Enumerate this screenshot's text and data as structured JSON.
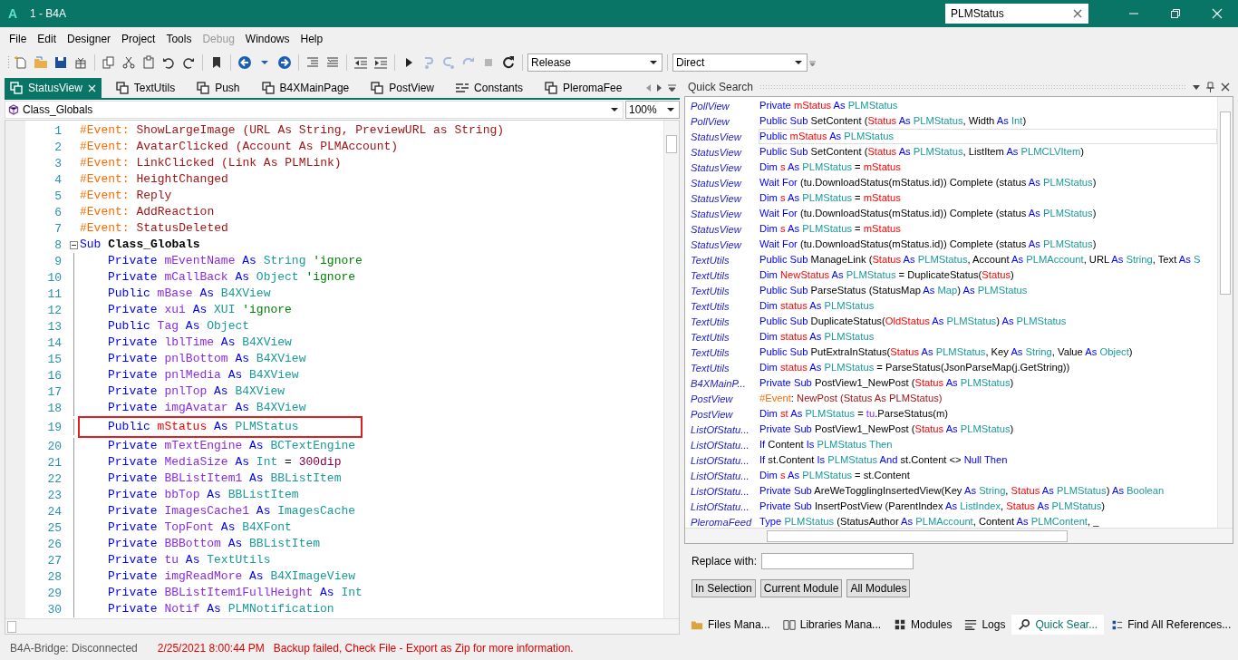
{
  "window": {
    "logo": "A",
    "title": "1 - B4A",
    "search": {
      "value": "PLMStatus"
    }
  },
  "menu": [
    {
      "label": "File",
      "disabled": false
    },
    {
      "label": "Edit",
      "disabled": false
    },
    {
      "label": "Designer",
      "disabled": false
    },
    {
      "label": "Project",
      "disabled": false
    },
    {
      "label": "Tools",
      "disabled": false
    },
    {
      "label": "Debug",
      "disabled": true
    },
    {
      "label": "Windows",
      "disabled": false
    },
    {
      "label": "Help",
      "disabled": false
    }
  ],
  "toolbar": {
    "buttons": [
      {
        "disabled": false
      },
      {
        "disabled": false
      },
      {
        "disabled": false
      },
      {
        "disabled": false
      },
      {
        "disabled": false
      },
      {
        "disabled": false
      },
      {
        "disabled": false
      },
      {
        "disabled": false
      },
      {
        "disabled": false
      },
      {
        "disabled": false
      },
      {
        "disabled": false
      },
      {
        "disabled": false
      },
      {
        "disabled": false
      },
      {
        "disabled": false
      },
      {
        "disabled": false
      },
      {
        "disabled": false
      },
      {
        "disabled": false
      },
      {
        "disabled": false
      },
      {
        "disabled": true
      },
      {
        "disabled": true
      },
      {
        "disabled": true
      },
      {
        "disabled": true
      },
      {
        "disabled": false
      }
    ],
    "configuration": "Release",
    "connection": "Direct"
  },
  "editor_tabs": [
    {
      "label": "StatusView",
      "kind": "module",
      "selected": true
    },
    {
      "label": "TextUtils",
      "kind": "module",
      "selected": false
    },
    {
      "label": "Push",
      "kind": "module",
      "selected": false
    },
    {
      "label": "B4XMainPage",
      "kind": "module",
      "selected": false
    },
    {
      "label": "PostView",
      "kind": "module",
      "selected": false
    },
    {
      "label": "Constants",
      "kind": "constants",
      "selected": false
    },
    {
      "label": "PleromaFee",
      "kind": "module",
      "selected": false
    }
  ],
  "member_dropdown": "Class_Globals",
  "zoom": "100%",
  "code": {
    "lines": [
      {
        "number": "1",
        "marked": false,
        "tokens": [
          {
            "kind": "ev",
            "text": "#Event:"
          },
          {
            "kind": "evt",
            "text": " ShowLargeImage (URL As String, PreviewURL as String)"
          }
        ]
      },
      {
        "number": "2",
        "marked": false,
        "tokens": [
          {
            "kind": "ev",
            "text": "#Event:"
          },
          {
            "kind": "evt",
            "text": " AvatarClicked (Account As PLMAccount)"
          }
        ]
      },
      {
        "number": "3",
        "marked": false,
        "tokens": [
          {
            "kind": "ev",
            "text": "#Event:"
          },
          {
            "kind": "evt",
            "text": " LinkClicked (Link As PLMLink)"
          }
        ]
      },
      {
        "number": "4",
        "marked": false,
        "tokens": [
          {
            "kind": "ev",
            "text": "#Event:"
          },
          {
            "kind": "evt",
            "text": " HeightChanged"
          }
        ]
      },
      {
        "number": "5",
        "marked": false,
        "tokens": [
          {
            "kind": "ev",
            "text": "#Event:"
          },
          {
            "kind": "evt",
            "text": " Reply"
          }
        ]
      },
      {
        "number": "6",
        "marked": false,
        "tokens": [
          {
            "kind": "ev",
            "text": "#Event:"
          },
          {
            "kind": "evt",
            "text": " AddReaction"
          }
        ]
      },
      {
        "number": "7",
        "marked": false,
        "tokens": [
          {
            "kind": "ev",
            "text": "#Event:"
          },
          {
            "kind": "evt",
            "text": " StatusDeleted"
          }
        ]
      },
      {
        "number": "8",
        "marked": false,
        "expanded": true,
        "tokens": [
          {
            "kind": "kw",
            "text": "Sub "
          },
          {
            "kind": "bold",
            "text": "Class_Globals"
          }
        ],
        "children": [
          {
            "number": "9",
            "marked": false,
            "tokens": [
              {
                "kind": "kw",
                "text": "Private "
              },
              {
                "kind": "var",
                "text": "mEventName "
              },
              {
                "kind": "kw",
                "text": "As "
              },
              {
                "kind": "type",
                "text": "String "
              },
              {
                "kind": "cm",
                "text": "'ignore"
              }
            ]
          },
          {
            "number": "10",
            "marked": false,
            "tokens": [
              {
                "kind": "kw",
                "text": "Private "
              },
              {
                "kind": "var",
                "text": "mCallBack "
              },
              {
                "kind": "kw",
                "text": "As "
              },
              {
                "kind": "type",
                "text": "Object "
              },
              {
                "kind": "cm",
                "text": "'ignore"
              }
            ]
          },
          {
            "number": "11",
            "marked": false,
            "tokens": [
              {
                "kind": "kw",
                "text": "Public "
              },
              {
                "kind": "var",
                "text": "mBase "
              },
              {
                "kind": "kw",
                "text": "As "
              },
              {
                "kind": "type",
                "text": "B4XView"
              }
            ]
          },
          {
            "number": "12",
            "marked": false,
            "tokens": [
              {
                "kind": "kw",
                "text": "Private "
              },
              {
                "kind": "var",
                "text": "xui "
              },
              {
                "kind": "kw",
                "text": "As "
              },
              {
                "kind": "type",
                "text": "XUI "
              },
              {
                "kind": "cm",
                "text": "'ignore"
              }
            ]
          },
          {
            "number": "13",
            "marked": false,
            "tokens": [
              {
                "kind": "kw",
                "text": "Public "
              },
              {
                "kind": "var",
                "text": "Tag "
              },
              {
                "kind": "kw",
                "text": "As "
              },
              {
                "kind": "type",
                "text": "Object"
              }
            ]
          },
          {
            "number": "14",
            "marked": false,
            "tokens": [
              {
                "kind": "kw",
                "text": "Private "
              },
              {
                "kind": "var",
                "text": "lblTime "
              },
              {
                "kind": "kw",
                "text": "As "
              },
              {
                "kind": "type",
                "text": "B4XView"
              }
            ]
          },
          {
            "number": "15",
            "marked": false,
            "tokens": [
              {
                "kind": "kw",
                "text": "Private "
              },
              {
                "kind": "var",
                "text": "pnlBottom "
              },
              {
                "kind": "kw",
                "text": "As "
              },
              {
                "kind": "type",
                "text": "B4XView"
              }
            ]
          },
          {
            "number": "16",
            "marked": false,
            "tokens": [
              {
                "kind": "kw",
                "text": "Private "
              },
              {
                "kind": "var",
                "text": "pnlMedia "
              },
              {
                "kind": "kw",
                "text": "As "
              },
              {
                "kind": "type",
                "text": "B4XView"
              }
            ]
          },
          {
            "number": "17",
            "marked": false,
            "tokens": [
              {
                "kind": "kw",
                "text": "Private "
              },
              {
                "kind": "var",
                "text": "pnlTop "
              },
              {
                "kind": "kw",
                "text": "As "
              },
              {
                "kind": "type",
                "text": "B4XView"
              }
            ]
          },
          {
            "number": "18",
            "marked": false,
            "tokens": [
              {
                "kind": "kw",
                "text": "Private "
              },
              {
                "kind": "var",
                "text": "imgAvatar "
              },
              {
                "kind": "kw",
                "text": "As "
              },
              {
                "kind": "type",
                "text": "B4XView"
              }
            ]
          },
          {
            "number": "19",
            "marked": true,
            "tokens": [
              {
                "kind": "kw",
                "text": "Public "
              },
              {
                "kind": "hit",
                "text": "mStatus "
              },
              {
                "kind": "kw",
                "text": "As "
              },
              {
                "kind": "type",
                "text": "PLMStatus"
              }
            ]
          },
          {
            "number": "20",
            "marked": false,
            "tokens": [
              {
                "kind": "kw",
                "text": "Private "
              },
              {
                "kind": "var",
                "text": "mTextEngine "
              },
              {
                "kind": "kw",
                "text": "As "
              },
              {
                "kind": "type",
                "text": "BCTextEngine"
              }
            ]
          },
          {
            "number": "21",
            "marked": false,
            "tokens": [
              {
                "kind": "kw",
                "text": "Private "
              },
              {
                "kind": "var",
                "text": "MediaSize "
              },
              {
                "kind": "kw",
                "text": "As "
              },
              {
                "kind": "type",
                "text": "Int"
              },
              {
                "kind": "pl",
                "text": " = "
              },
              {
                "kind": "num",
                "text": "300dip"
              }
            ]
          },
          {
            "number": "22",
            "marked": false,
            "tokens": [
              {
                "kind": "kw",
                "text": "Private "
              },
              {
                "kind": "var",
                "text": "BBListItem1 "
              },
              {
                "kind": "kw",
                "text": "As "
              },
              {
                "kind": "type",
                "text": "BBListItem"
              }
            ]
          },
          {
            "number": "23",
            "marked": false,
            "tokens": [
              {
                "kind": "kw",
                "text": "Private "
              },
              {
                "kind": "var",
                "text": "bbTop "
              },
              {
                "kind": "kw",
                "text": "As "
              },
              {
                "kind": "type",
                "text": "BBListItem"
              }
            ]
          },
          {
            "number": "24",
            "marked": false,
            "tokens": [
              {
                "kind": "kw",
                "text": "Private "
              },
              {
                "kind": "var",
                "text": "ImagesCache1 "
              },
              {
                "kind": "kw",
                "text": "As "
              },
              {
                "kind": "type",
                "text": "ImagesCache"
              }
            ]
          },
          {
            "number": "25",
            "marked": false,
            "tokens": [
              {
                "kind": "kw",
                "text": "Private "
              },
              {
                "kind": "var",
                "text": "TopFont "
              },
              {
                "kind": "kw",
                "text": "As "
              },
              {
                "kind": "type",
                "text": "B4XFont"
              }
            ]
          },
          {
            "number": "26",
            "marked": false,
            "tokens": [
              {
                "kind": "kw",
                "text": "Private "
              },
              {
                "kind": "var",
                "text": "BBBottom "
              },
              {
                "kind": "kw",
                "text": "As "
              },
              {
                "kind": "type",
                "text": "BBListItem"
              }
            ]
          },
          {
            "number": "27",
            "marked": false,
            "tokens": [
              {
                "kind": "kw",
                "text": "Private "
              },
              {
                "kind": "var",
                "text": "tu "
              },
              {
                "kind": "kw",
                "text": "As "
              },
              {
                "kind": "type",
                "text": "TextUtils"
              }
            ]
          },
          {
            "number": "28",
            "marked": false,
            "tokens": [
              {
                "kind": "kw",
                "text": "Private "
              },
              {
                "kind": "var",
                "text": "imgReadMore "
              },
              {
                "kind": "kw",
                "text": "As "
              },
              {
                "kind": "type",
                "text": "B4XImageView"
              }
            ]
          },
          {
            "number": "29",
            "marked": false,
            "tokens": [
              {
                "kind": "kw",
                "text": "Private "
              },
              {
                "kind": "var",
                "text": "BBListItem1FullHeight "
              },
              {
                "kind": "kw",
                "text": "As "
              },
              {
                "kind": "type",
                "text": "Int"
              }
            ]
          },
          {
            "number": "30",
            "marked": false,
            "tokens": [
              {
                "kind": "kw",
                "text": "Private "
              },
              {
                "kind": "var",
                "text": "Notif "
              },
              {
                "kind": "kw",
                "text": "As "
              },
              {
                "kind": "type",
                "text": "PLMNotification"
              }
            ]
          }
        ]
      }
    ]
  },
  "quick_search": {
    "title": "Quick Search",
    "results": [
      {
        "module": "PollView",
        "selected": false,
        "tokens": [
          {
            "kind": "kw",
            "text": "Private "
          },
          {
            "kind": "hit",
            "text": "mStatus "
          },
          {
            "kind": "kw",
            "text": "As "
          },
          {
            "kind": "type",
            "text": "PLMStatus"
          }
        ]
      },
      {
        "module": "PollView",
        "selected": false,
        "tokens": [
          {
            "kind": "kw",
            "text": "Public Sub "
          },
          {
            "kind": "pl",
            "text": "SetContent ("
          },
          {
            "kind": "hit",
            "text": "Status "
          },
          {
            "kind": "kw",
            "text": "As "
          },
          {
            "kind": "type",
            "text": "PLMStatus"
          },
          {
            "kind": "pl",
            "text": ", Width "
          },
          {
            "kind": "kw",
            "text": "As "
          },
          {
            "kind": "type",
            "text": "Int"
          },
          {
            "kind": "pl",
            "text": ")"
          }
        ]
      },
      {
        "module": "StatusView",
        "selected": true,
        "tokens": [
          {
            "kind": "kw",
            "text": "Public "
          },
          {
            "kind": "hit",
            "text": "mStatus "
          },
          {
            "kind": "kw",
            "text": "As "
          },
          {
            "kind": "type",
            "text": "PLMStatus"
          }
        ]
      },
      {
        "module": "StatusView",
        "selected": false,
        "tokens": [
          {
            "kind": "kw",
            "text": "Public Sub "
          },
          {
            "kind": "pl",
            "text": "SetContent ("
          },
          {
            "kind": "hit",
            "text": "Status "
          },
          {
            "kind": "kw",
            "text": "As "
          },
          {
            "kind": "type",
            "text": "PLMStatus"
          },
          {
            "kind": "pl",
            "text": ", ListItem "
          },
          {
            "kind": "kw",
            "text": "As "
          },
          {
            "kind": "type",
            "text": "PLMCLVItem"
          },
          {
            "kind": "pl",
            "text": ")"
          }
        ]
      },
      {
        "module": "StatusView",
        "selected": false,
        "tokens": [
          {
            "kind": "kw",
            "text": "Dim "
          },
          {
            "kind": "hit",
            "text": "s "
          },
          {
            "kind": "kw",
            "text": "As "
          },
          {
            "kind": "type",
            "text": "PLMStatus"
          },
          {
            "kind": "pl",
            "text": " = "
          },
          {
            "kind": "hit",
            "text": "mStatus"
          }
        ]
      },
      {
        "module": "StatusView",
        "selected": false,
        "tokens": [
          {
            "kind": "kw",
            "text": "Wait For "
          },
          {
            "kind": "pl",
            "text": "(tu.DownloadStatus(mStatus.id)) Complete (status "
          },
          {
            "kind": "kw",
            "text": "As "
          },
          {
            "kind": "type",
            "text": "PLMStatus"
          },
          {
            "kind": "pl",
            "text": ")"
          }
        ]
      },
      {
        "module": "StatusView",
        "selected": false,
        "tokens": [
          {
            "kind": "kw",
            "text": "Dim "
          },
          {
            "kind": "hit",
            "text": "s "
          },
          {
            "kind": "kw",
            "text": "As "
          },
          {
            "kind": "type",
            "text": "PLMStatus"
          },
          {
            "kind": "pl",
            "text": " = "
          },
          {
            "kind": "hit",
            "text": "mStatus"
          }
        ]
      },
      {
        "module": "StatusView",
        "selected": false,
        "tokens": [
          {
            "kind": "kw",
            "text": "Wait For "
          },
          {
            "kind": "pl",
            "text": "(tu.DownloadStatus(mStatus.id)) Complete (status "
          },
          {
            "kind": "kw",
            "text": "As "
          },
          {
            "kind": "type",
            "text": "PLMStatus"
          },
          {
            "kind": "pl",
            "text": ")"
          }
        ]
      },
      {
        "module": "StatusView",
        "selected": false,
        "tokens": [
          {
            "kind": "kw",
            "text": "Dim "
          },
          {
            "kind": "hit",
            "text": "s "
          },
          {
            "kind": "kw",
            "text": "As "
          },
          {
            "kind": "type",
            "text": "PLMStatus"
          },
          {
            "kind": "pl",
            "text": " = "
          },
          {
            "kind": "hit",
            "text": "mStatus"
          }
        ]
      },
      {
        "module": "StatusView",
        "selected": false,
        "tokens": [
          {
            "kind": "kw",
            "text": "Wait For "
          },
          {
            "kind": "pl",
            "text": "(tu.DownloadStatus(mStatus.id)) Complete (status "
          },
          {
            "kind": "kw",
            "text": "As "
          },
          {
            "kind": "type",
            "text": "PLMStatus"
          },
          {
            "kind": "pl",
            "text": ")"
          }
        ]
      },
      {
        "module": "TextUtils",
        "selected": false,
        "tokens": [
          {
            "kind": "kw",
            "text": "Public Sub "
          },
          {
            "kind": "pl",
            "text": "ManageLink ("
          },
          {
            "kind": "hit",
            "text": "Status "
          },
          {
            "kind": "kw",
            "text": "As "
          },
          {
            "kind": "type",
            "text": "PLMStatus"
          },
          {
            "kind": "pl",
            "text": ", Account "
          },
          {
            "kind": "kw",
            "text": "As "
          },
          {
            "kind": "type",
            "text": "PLMAccount"
          },
          {
            "kind": "pl",
            "text": ", URL "
          },
          {
            "kind": "kw",
            "text": "As "
          },
          {
            "kind": "type",
            "text": "String"
          },
          {
            "kind": "pl",
            "text": ", Text "
          },
          {
            "kind": "kw",
            "text": "As "
          },
          {
            "kind": "type",
            "text": "S"
          }
        ]
      },
      {
        "module": "TextUtils",
        "selected": false,
        "tokens": [
          {
            "kind": "kw",
            "text": "Dim "
          },
          {
            "kind": "hit",
            "text": "NewStatus "
          },
          {
            "kind": "kw",
            "text": "As "
          },
          {
            "kind": "type",
            "text": "PLMStatus"
          },
          {
            "kind": "pl",
            "text": " = DuplicateStatus("
          },
          {
            "kind": "hit",
            "text": "Status"
          },
          {
            "kind": "pl",
            "text": ")"
          }
        ]
      },
      {
        "module": "TextUtils",
        "selected": false,
        "tokens": [
          {
            "kind": "kw",
            "text": "Public Sub "
          },
          {
            "kind": "pl",
            "text": "ParseStatus (StatusMap "
          },
          {
            "kind": "kw",
            "text": "As "
          },
          {
            "kind": "type",
            "text": "Map"
          },
          {
            "kind": "pl",
            "text": ") "
          },
          {
            "kind": "kw",
            "text": "As "
          },
          {
            "kind": "type",
            "text": "PLMStatus"
          }
        ]
      },
      {
        "module": "TextUtils",
        "selected": false,
        "tokens": [
          {
            "kind": "kw",
            "text": "Dim "
          },
          {
            "kind": "hit",
            "text": "status "
          },
          {
            "kind": "kw",
            "text": "As "
          },
          {
            "kind": "type",
            "text": "PLMStatus"
          }
        ]
      },
      {
        "module": "TextUtils",
        "selected": false,
        "tokens": [
          {
            "kind": "kw",
            "text": "Public Sub "
          },
          {
            "kind": "pl",
            "text": "DuplicateStatus("
          },
          {
            "kind": "hit",
            "text": "OldStatus "
          },
          {
            "kind": "kw",
            "text": "As "
          },
          {
            "kind": "type",
            "text": "PLMStatus"
          },
          {
            "kind": "pl",
            "text": ") "
          },
          {
            "kind": "kw",
            "text": "As "
          },
          {
            "kind": "type",
            "text": "PLMStatus"
          }
        ]
      },
      {
        "module": "TextUtils",
        "selected": false,
        "tokens": [
          {
            "kind": "kw",
            "text": "Dim "
          },
          {
            "kind": "hit",
            "text": "status "
          },
          {
            "kind": "kw",
            "text": "As "
          },
          {
            "kind": "type",
            "text": "PLMStatus"
          }
        ]
      },
      {
        "module": "TextUtils",
        "selected": false,
        "tokens": [
          {
            "kind": "kw",
            "text": "Public Sub "
          },
          {
            "kind": "pl",
            "text": "PutExtraInStatus("
          },
          {
            "kind": "hit",
            "text": "Status "
          },
          {
            "kind": "kw",
            "text": "As "
          },
          {
            "kind": "type",
            "text": "PLMStatus"
          },
          {
            "kind": "pl",
            "text": ", Key "
          },
          {
            "kind": "kw",
            "text": "As "
          },
          {
            "kind": "type",
            "text": "String"
          },
          {
            "kind": "pl",
            "text": ", Value "
          },
          {
            "kind": "kw",
            "text": "As "
          },
          {
            "kind": "type",
            "text": "Object"
          },
          {
            "kind": "pl",
            "text": ")"
          }
        ]
      },
      {
        "module": "TextUtils",
        "selected": false,
        "tokens": [
          {
            "kind": "kw",
            "text": "Dim "
          },
          {
            "kind": "hit",
            "text": "status "
          },
          {
            "kind": "kw",
            "text": "As "
          },
          {
            "kind": "type",
            "text": "PLMStatus"
          },
          {
            "kind": "pl",
            "text": " = ParseStatus(JsonParseMap(j.GetString))"
          }
        ]
      },
      {
        "module": "B4XMainP...",
        "selected": false,
        "tokens": [
          {
            "kind": "kw",
            "text": "Private Sub "
          },
          {
            "kind": "pl",
            "text": "PostView1_NewPost ("
          },
          {
            "kind": "hit",
            "text": "Status "
          },
          {
            "kind": "kw",
            "text": "As "
          },
          {
            "kind": "type",
            "text": "PLMStatus"
          },
          {
            "kind": "pl",
            "text": ")"
          }
        ]
      },
      {
        "module": "PostView",
        "selected": false,
        "tokens": [
          {
            "kind": "ev",
            "text": "#Event"
          },
          {
            "kind": "pl",
            "text": ": "
          },
          {
            "kind": "evt",
            "text": "NewPost (Status As PLMStatus)"
          }
        ]
      },
      {
        "module": "PostView",
        "selected": false,
        "tokens": [
          {
            "kind": "kw",
            "text": "Dim "
          },
          {
            "kind": "hit",
            "text": "st "
          },
          {
            "kind": "kw",
            "text": "As "
          },
          {
            "kind": "type",
            "text": "PLMStatus"
          },
          {
            "kind": "pl",
            "text": " = "
          },
          {
            "kind": "var",
            "text": "tu"
          },
          {
            "kind": "pl",
            "text": ".ParseStatus(m)"
          }
        ]
      },
      {
        "module": "ListOfStatu...",
        "selected": false,
        "tokens": [
          {
            "kind": "kw",
            "text": "Private Sub "
          },
          {
            "kind": "pl",
            "text": "PostView1_NewPost ("
          },
          {
            "kind": "hit",
            "text": "Status "
          },
          {
            "kind": "kw",
            "text": "As "
          },
          {
            "kind": "type",
            "text": "PLMStatus"
          },
          {
            "kind": "pl",
            "text": ")"
          }
        ]
      },
      {
        "module": "ListOfStatu...",
        "selected": false,
        "tokens": [
          {
            "kind": "kw",
            "text": "If "
          },
          {
            "kind": "pl",
            "text": "Content "
          },
          {
            "kind": "kw",
            "text": "Is "
          },
          {
            "kind": "type",
            "text": "PLMStatus Then"
          }
        ]
      },
      {
        "module": "ListOfStatu...",
        "selected": false,
        "tokens": [
          {
            "kind": "kw",
            "text": "If "
          },
          {
            "kind": "pl",
            "text": "st.Content "
          },
          {
            "kind": "kw",
            "text": "Is "
          },
          {
            "kind": "type",
            "text": "PLMStatus "
          },
          {
            "kind": "kw",
            "text": "And "
          },
          {
            "kind": "pl",
            "text": "st.Content <> "
          },
          {
            "kind": "kw",
            "text": "Null Then"
          }
        ]
      },
      {
        "module": "ListOfStatu...",
        "selected": false,
        "tokens": [
          {
            "kind": "kw",
            "text": "Dim "
          },
          {
            "kind": "hit",
            "text": "s "
          },
          {
            "kind": "kw",
            "text": "As "
          },
          {
            "kind": "type",
            "text": "PLMStatus"
          },
          {
            "kind": "pl",
            "text": " = st.Content"
          }
        ]
      },
      {
        "module": "ListOfStatu...",
        "selected": false,
        "tokens": [
          {
            "kind": "kw",
            "text": "Private Sub "
          },
          {
            "kind": "pl",
            "text": "AreWeTogglingInsertedView(Key "
          },
          {
            "kind": "kw",
            "text": "As "
          },
          {
            "kind": "type",
            "text": "String"
          },
          {
            "kind": "pl",
            "text": ", "
          },
          {
            "kind": "hit",
            "text": "Status "
          },
          {
            "kind": "kw",
            "text": "As "
          },
          {
            "kind": "type",
            "text": "PLMStatus"
          },
          {
            "kind": "pl",
            "text": ") "
          },
          {
            "kind": "kw",
            "text": "As "
          },
          {
            "kind": "type",
            "text": "Boolean"
          }
        ]
      },
      {
        "module": "ListOfStatu...",
        "selected": false,
        "tokens": [
          {
            "kind": "kw",
            "text": "Private Sub "
          },
          {
            "kind": "pl",
            "text": "InsertPostView (ParentIndex "
          },
          {
            "kind": "kw",
            "text": "As "
          },
          {
            "kind": "type",
            "text": "ListIndex"
          },
          {
            "kind": "pl",
            "text": ", "
          },
          {
            "kind": "hit",
            "text": "Status "
          },
          {
            "kind": "kw",
            "text": "As "
          },
          {
            "kind": "type",
            "text": "PLMStatus"
          },
          {
            "kind": "pl",
            "text": ")"
          }
        ]
      },
      {
        "module": "PleromaFeed",
        "selected": false,
        "tokens": [
          {
            "kind": "kw",
            "text": "Type "
          },
          {
            "kind": "type",
            "text": "PLMStatus "
          },
          {
            "kind": "pl",
            "text": "(StatusAuthor "
          },
          {
            "kind": "kw",
            "text": "As "
          },
          {
            "kind": "type",
            "text": "PLMAccount"
          },
          {
            "kind": "pl",
            "text": ", Content "
          },
          {
            "kind": "kw",
            "text": "As "
          },
          {
            "kind": "type",
            "text": "PLMContent"
          },
          {
            "kind": "pl",
            "text": ", _"
          }
        ]
      }
    ],
    "replace_label": "Replace with:",
    "buttons": [
      "In Selection",
      "Current Module",
      "All Modules"
    ]
  },
  "panel_tabs": [
    {
      "label": "Files Mana...",
      "selected": false
    },
    {
      "label": "Libraries Mana...",
      "selected": false
    },
    {
      "label": "Modules",
      "selected": false
    },
    {
      "label": "Logs",
      "selected": false
    },
    {
      "label": "Quick Sear...",
      "selected": true
    },
    {
      "label": "Find All References...",
      "selected": false
    }
  ],
  "status_bar": {
    "bridge": "B4A-Bridge: Disconnected",
    "time": "2/25/2021 8:00:44 PM",
    "message": "Backup failed, Check File - Export as Zip for more information."
  }
}
